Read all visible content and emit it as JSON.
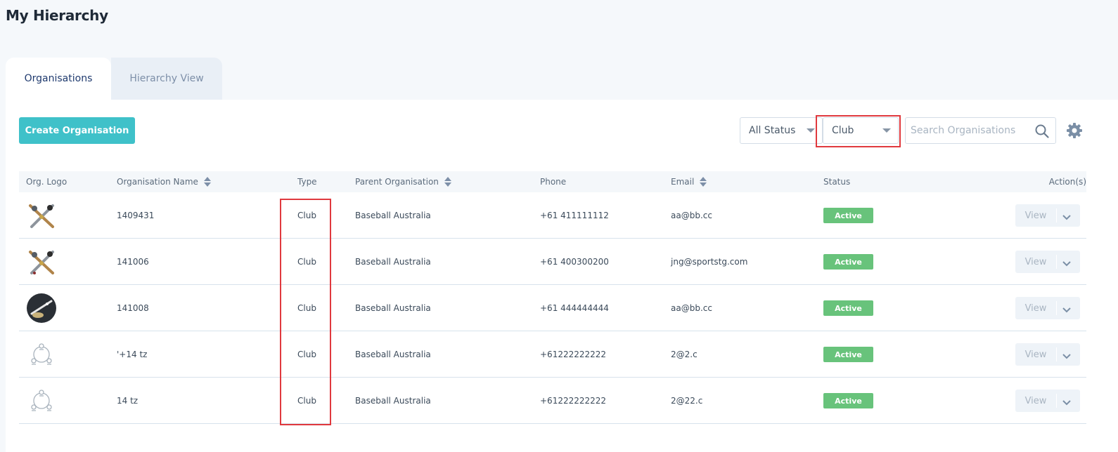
{
  "page": {
    "title": "My Hierarchy"
  },
  "tabs": [
    {
      "label": "Organisations",
      "active": true
    },
    {
      "label": "Hierarchy View",
      "active": false
    }
  ],
  "toolbar": {
    "create_label": "Create Organisation",
    "status_filter": "All Status",
    "type_filter": "Club",
    "search_placeholder": "Search Organisations"
  },
  "table": {
    "columns": {
      "logo": "Org. Logo",
      "name": "Organisation Name",
      "type": "Type",
      "parent": "Parent Organisation",
      "phone": "Phone",
      "email": "Email",
      "status": "Status",
      "actions": "Action(s)"
    },
    "view_label": "View",
    "rows": [
      {
        "logo": "crossed-bats-logo",
        "name": "1409431",
        "type": "Club",
        "parent": "Baseball Australia",
        "phone": "+61 411111112",
        "email": "aa@bb.cc",
        "status": "Active"
      },
      {
        "logo": "crossed-bats-logo",
        "name": "141006",
        "type": "Club",
        "parent": "Baseball Australia",
        "phone": "+61 400300200",
        "email": "jng@sportstg.com",
        "status": "Active"
      },
      {
        "logo": "round-dark-logo",
        "name": "141008",
        "type": "Club",
        "parent": "Baseball Australia",
        "phone": "+61 444444444",
        "email": "aa@bb.cc",
        "status": "Active"
      },
      {
        "logo": "hierarchy-placeholder-icon",
        "name": "'+14 tz",
        "type": "Club",
        "parent": "Baseball Australia",
        "phone": "+61222222222",
        "email": "2@2.c",
        "status": "Active"
      },
      {
        "logo": "hierarchy-placeholder-icon",
        "name": "14 tz",
        "type": "Club",
        "parent": "Baseball Australia",
        "phone": "+61222222222",
        "email": "2@22.c",
        "status": "Active"
      }
    ]
  },
  "colors": {
    "accent": "#3fc1c9",
    "active_badge": "#68c37b",
    "highlight": "#e0393e"
  }
}
